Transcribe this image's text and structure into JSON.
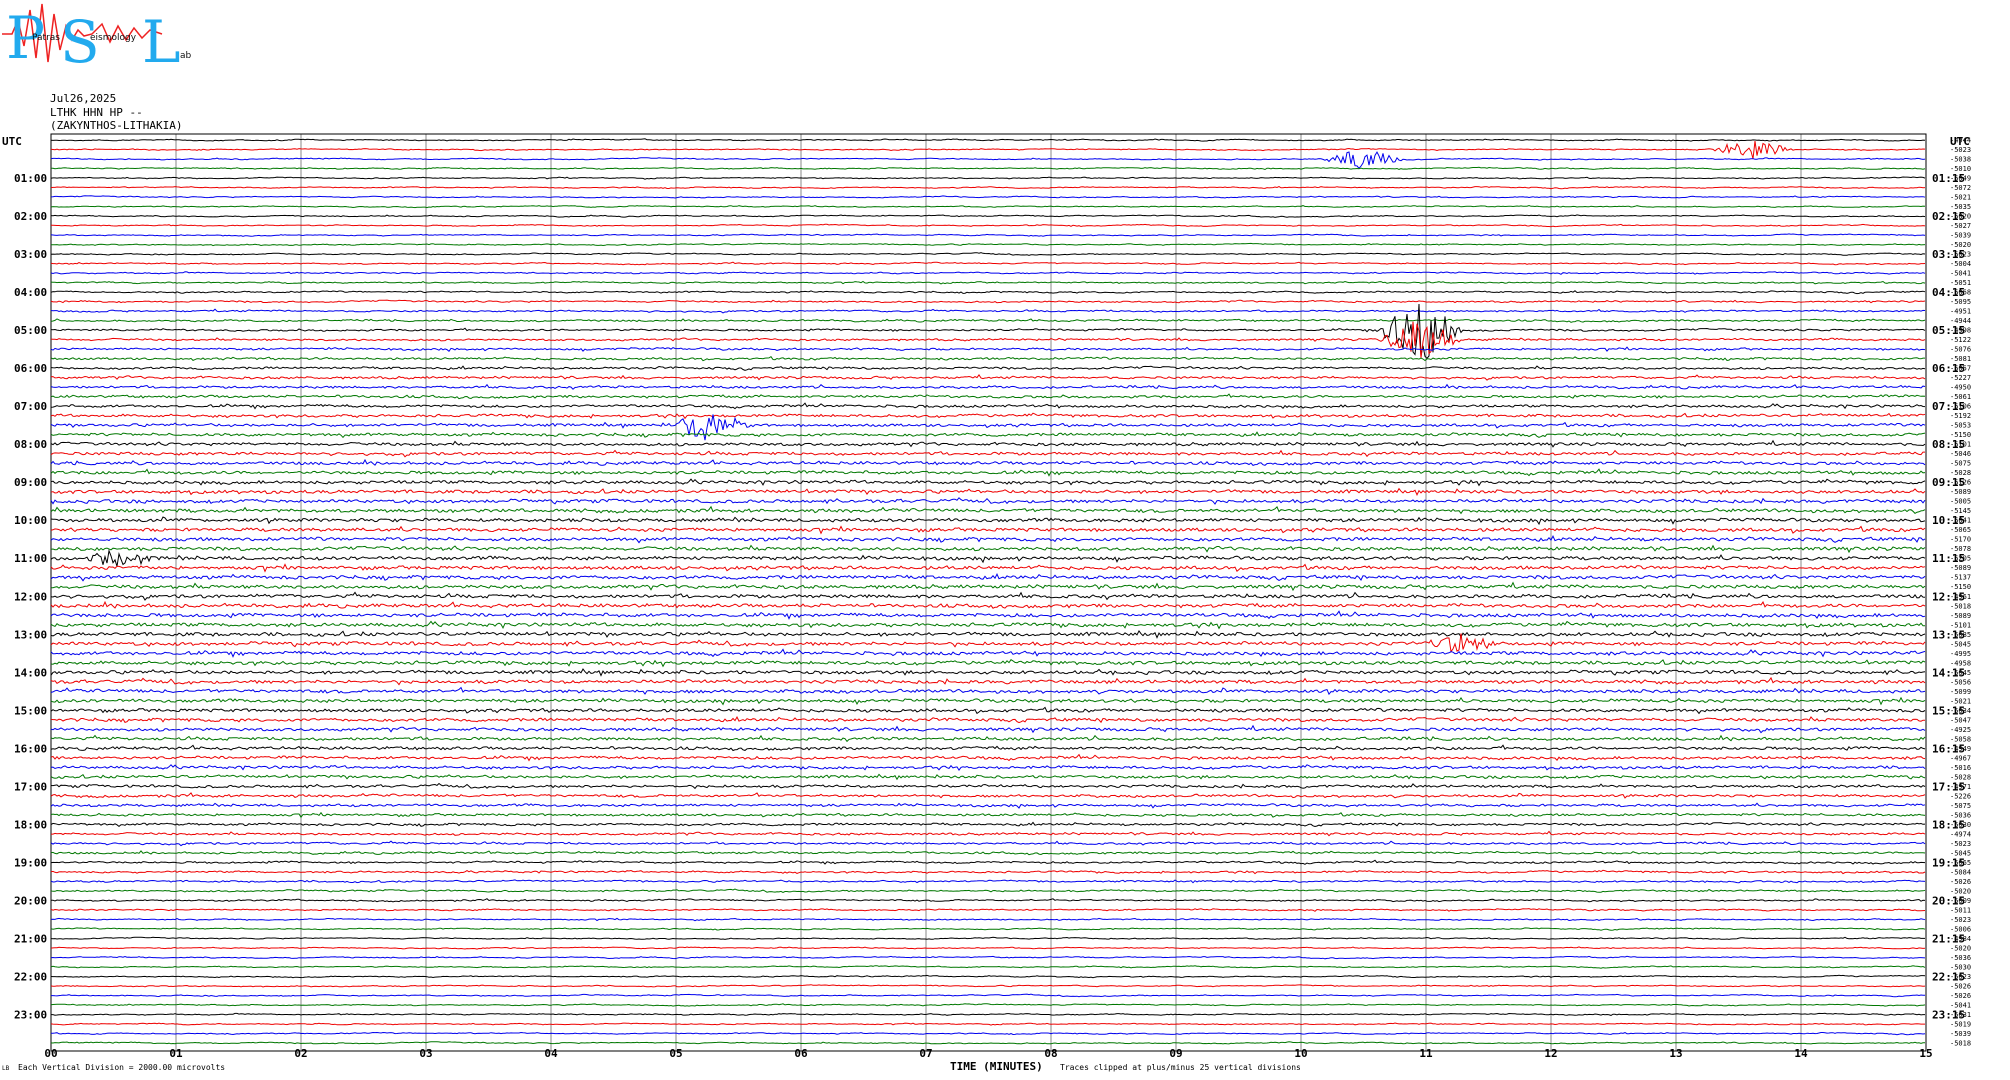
{
  "logo": {
    "letters": [
      "P",
      "S",
      "L"
    ],
    "subtitle_words": [
      "Patras",
      "eismology",
      "ab"
    ],
    "colors": {
      "letters": "#22aaee",
      "wave": "#ee2222"
    }
  },
  "header": {
    "date": "Jul26,2025",
    "station": "LTHK HHN HP --",
    "location": "(ZAKYNTHOS-LITHAKIA)"
  },
  "axes": {
    "left_title": "UTC",
    "right_title": "UTC",
    "xlabel": "TIME (MINUTES)",
    "footer_left": "Each Vertical Division = 2000.00 microvolts",
    "footer_right": "Traces clipped at plus/minus 25 vertical divisions",
    "corner_mark": "LB"
  },
  "chart_data": {
    "type": "line",
    "subtype": "helicorder",
    "x_ticks": [
      "00",
      "01",
      "02",
      "03",
      "04",
      "05",
      "06",
      "07",
      "08",
      "09",
      "10",
      "11",
      "12",
      "13",
      "14",
      "15"
    ],
    "xlim": [
      0,
      15
    ],
    "trace_minutes": 15,
    "trace_count": 96,
    "trace_colors": [
      "#000000",
      "#ee0000",
      "#0000ee",
      "#007700"
    ],
    "grid": true,
    "left_hour_labels": [
      "01:00",
      "02:00",
      "03:00",
      "04:00",
      "05:00",
      "06:00",
      "07:00",
      "08:00",
      "09:00",
      "10:00",
      "11:00",
      "12:00",
      "13:00",
      "14:00",
      "15:00",
      "16:00",
      "17:00",
      "18:00",
      "19:00",
      "20:00",
      "21:00",
      "22:00",
      "23:00"
    ],
    "right_hour_labels": [
      "01:15",
      "02:15",
      "03:15",
      "04:15",
      "05:15",
      "06:15",
      "07:15",
      "08:15",
      "09:15",
      "10:15",
      "11:15",
      "12:15",
      "13:15",
      "14:15",
      "15:15",
      "16:15",
      "17:15",
      "18:15",
      "19:15",
      "20:15",
      "21:15",
      "22:15",
      "23:15"
    ],
    "trace_offsets": [
      "-4944",
      "-5023",
      "-5038",
      "-5010",
      "-5049",
      "-5072",
      "-5021",
      "-5035",
      "-5020",
      "-5027",
      "-5039",
      "-5020",
      "-5023",
      "-5004",
      "-5041",
      "-5051",
      "-5068",
      "-5095",
      "-4951",
      "-4944",
      "-4998",
      "-5122",
      "-5076",
      "-5081",
      "-5057",
      "-5227",
      "-4950",
      "-5061",
      "-5106",
      "-5192",
      "-5053",
      "-5150",
      "-5101",
      "-5046",
      "-5075",
      "-5028",
      "-5126",
      "-5089",
      "-5005",
      "-5145",
      "-5041",
      "-5065",
      "-5170",
      "-5078",
      "-5205",
      "-5089",
      "-5137",
      "-5150",
      "-4961",
      "-5018",
      "-5089",
      "-5101",
      "-5085",
      "-5045",
      "-4995",
      "-4958",
      "-5045",
      "-5056",
      "-5099",
      "-5021",
      "-5034",
      "-5047",
      "-4925",
      "-5058",
      "-4949",
      "-4967",
      "-5016",
      "-5028",
      "-4971",
      "-5226",
      "-5075",
      "-5036",
      "-5030",
      "-4974",
      "-5023",
      "-5045",
      "-5065",
      "-5084",
      "-5026",
      "-5020",
      "-5009",
      "-5011",
      "-5023",
      "-5006",
      "-4984",
      "-5020",
      "-5036",
      "-5030",
      "-5023",
      "-5026",
      "-5026",
      "-5041",
      "-5031",
      "-5019",
      "-5039",
      "-5018"
    ],
    "events": [
      {
        "trace": 20,
        "minute": 10.95,
        "amplitude": 3.4
      },
      {
        "trace": 21,
        "minute": 10.95,
        "amplitude": 2.2
      },
      {
        "trace": 30,
        "minute": 5.25,
        "amplitude": 1.6
      },
      {
        "trace": 2,
        "minute": 10.5,
        "amplitude": 1.1
      },
      {
        "trace": 1,
        "minute": 13.6,
        "amplitude": 1.0
      },
      {
        "trace": 44,
        "minute": 0.55,
        "amplitude": 1.0
      },
      {
        "trace": 53,
        "minute": 11.3,
        "amplitude": 1.0
      }
    ]
  }
}
